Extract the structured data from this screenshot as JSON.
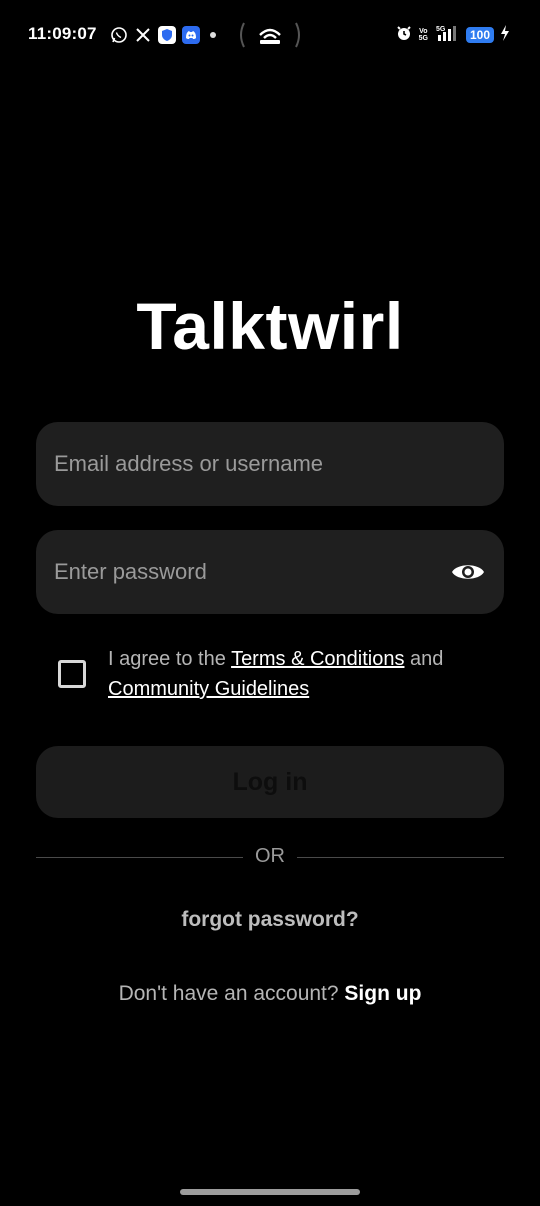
{
  "status_bar": {
    "time": "11:09:07",
    "notification_icons": [
      "whatsapp-icon",
      "x-icon",
      "shield-icon",
      "discord-icon",
      "more-dot-icon"
    ],
    "center_icon": "hotspot-icon",
    "network_label_top": "Vo",
    "network_label_bottom": "5G",
    "network_type": "5G",
    "battery": "100",
    "charging": true
  },
  "app": {
    "title": "Talktwirl"
  },
  "form": {
    "email_placeholder": "Email address or username",
    "password_placeholder": "Enter password",
    "agree_prefix": "I agree to the ",
    "terms_link": "Terms & Conditions",
    "agree_middle": " and",
    "guidelines_link": "Community Guidelines",
    "login_label": "Log in"
  },
  "divider": {
    "or_text": "OR"
  },
  "links": {
    "forgot_password": "forgot password?",
    "no_account_text": "Don't have an account? ",
    "signup_label": "Sign up"
  },
  "colors": {
    "background": "#000000",
    "field_background": "#1f1f1f",
    "button_background": "#1c1c1c",
    "placeholder": "#9a9a9a",
    "battery_badge": "#2f7cf0"
  }
}
